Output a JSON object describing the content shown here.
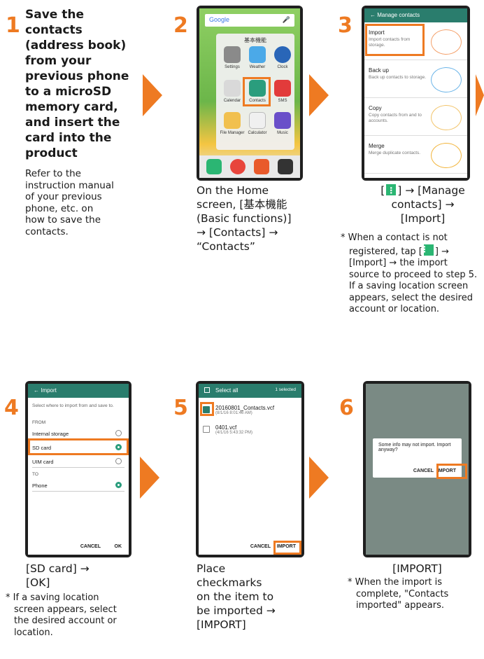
{
  "steps": [
    {
      "number": "1",
      "title_lines": [
        "Save the",
        "contacts",
        "(address book)",
        "from your",
        "previous phone",
        "to a microSD",
        "memory card,",
        "and insert the",
        "card into the",
        "product"
      ],
      "desc_lines": [
        "Refer to the",
        "instruction manual",
        "of your previous",
        "phone, etc. on",
        "how to save the",
        "contacts."
      ]
    },
    {
      "number": "2",
      "caption_lines": [
        "On the Home",
        "screen, [基本機能",
        "(Basic functions)]",
        "→ [Contacts] →",
        "“Contacts”"
      ],
      "screen": {
        "search": "Google",
        "folder_title": "基本機能",
        "apps": [
          "Settings",
          "Weather",
          "Clock",
          "Calendar",
          "Contacts",
          "SMS",
          "File Manager",
          "Calculator",
          "Music"
        ]
      }
    },
    {
      "number": "3",
      "caption_pre": "[",
      "caption_post": "] → [Manage",
      "caption_lines": [
        "contacts] →",
        "[Import]"
      ],
      "note_pre": "* When a contact is not registered, tap [",
      "note_post": "] → [Import] → the import source to proceed to step 5. If a saving location screen appears, select the desired account or location.",
      "screen": {
        "title": "← Manage contacts",
        "rows": [
          {
            "title": "Import",
            "desc": "Import contacts from storage."
          },
          {
            "title": "Back up",
            "desc": "Back up contacts to storage."
          },
          {
            "title": "Copy",
            "desc": "Copy contacts from and to accounts."
          },
          {
            "title": "Merge",
            "desc": "Merge duplicate contacts."
          }
        ]
      }
    },
    {
      "number": "4",
      "caption_lines": [
        "[SD card] →",
        "[OK]"
      ],
      "note": "* If a saving location screen appears, select the desired account or location.",
      "screen": {
        "title": "← Import",
        "instruction": "Select where to import from and save to.",
        "from_label": "FROM",
        "from_items": [
          "Internal storage",
          "SD card",
          "UIM card"
        ],
        "to_label": "TO",
        "to_items": [
          "Phone"
        ],
        "cancel": "CANCEL",
        "ok": "OK"
      }
    },
    {
      "number": "5",
      "caption_lines": [
        "Place",
        "checkmarks",
        "on the item to",
        "be imported →",
        "[IMPORT]"
      ],
      "screen": {
        "select_all": "Select all",
        "selected": "1 selected",
        "files": [
          {
            "name": "20160801_Contacts.vcf",
            "date": "(8/1/16 8:01:46 AM)"
          },
          {
            "name": "0401.vcf",
            "date": "(4/1/16 5:43:32 PM)"
          }
        ],
        "cancel": "CANCEL",
        "import": "IMPORT"
      }
    },
    {
      "number": "6",
      "caption": "[IMPORT]",
      "note": "* When the import is complete, \"Contacts imported\" appears.",
      "screen": {
        "message": "Some info may not import. Import anyway?",
        "cancel": "CANCEL",
        "import": "IMPORT"
      }
    }
  ],
  "colors": {
    "accent": "#ee7a22",
    "teal": "#2a7d6d",
    "menu_icon": "#2bb673"
  }
}
